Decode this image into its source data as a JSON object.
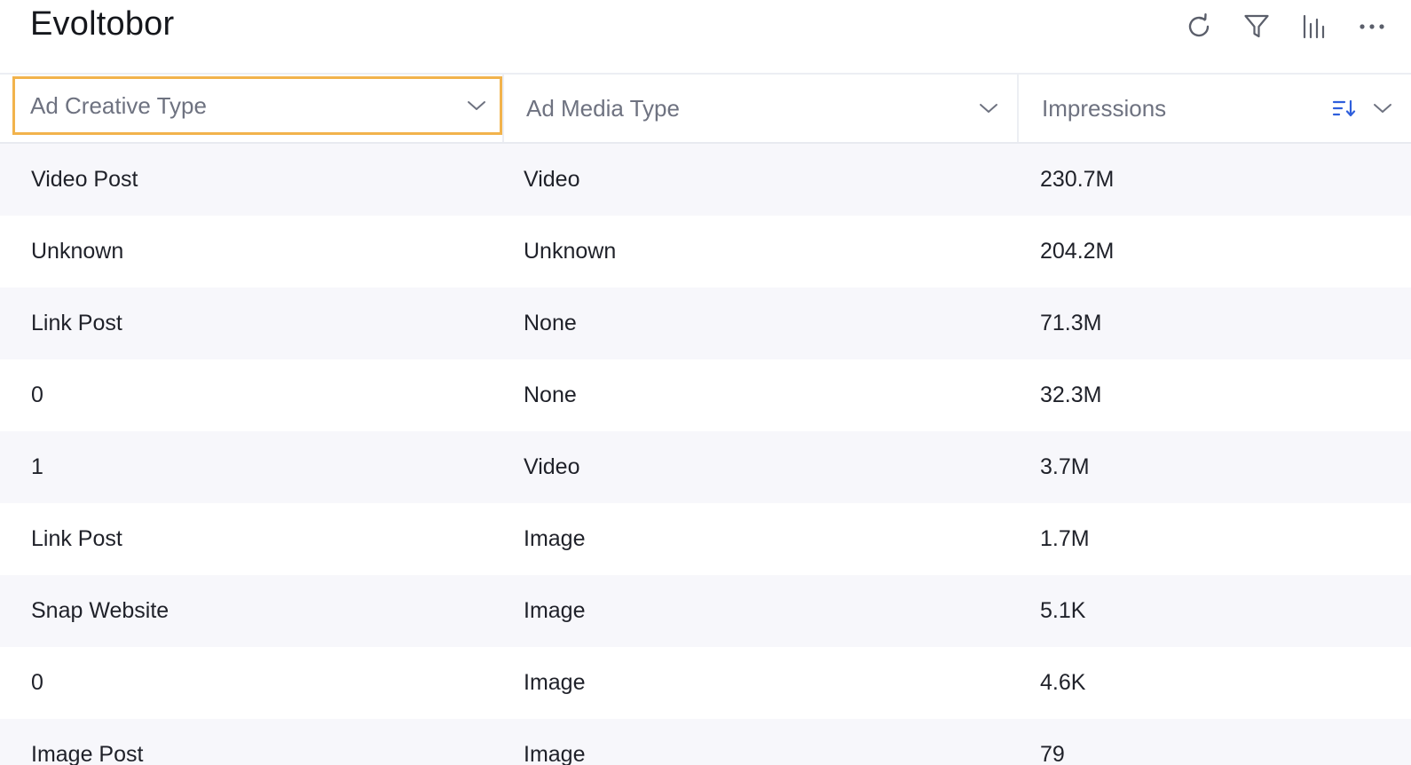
{
  "header": {
    "title": "Evoltobor",
    "toolbar": [
      {
        "icon": "refresh-icon"
      },
      {
        "icon": "filter-icon"
      },
      {
        "icon": "chart-bars-icon"
      },
      {
        "icon": "more-icon"
      }
    ]
  },
  "columns": [
    {
      "label": "Ad Creative Type",
      "focused": true
    },
    {
      "label": "Ad Media Type"
    },
    {
      "label": "Impressions",
      "sorted": "descending"
    }
  ],
  "rows": [
    [
      "Video Post",
      "Video",
      "230.7M"
    ],
    [
      "Unknown",
      "Unknown",
      "204.2M"
    ],
    [
      "Link Post",
      "None",
      "71.3M"
    ],
    [
      "0",
      "None",
      "32.3M"
    ],
    [
      "1",
      "Video",
      "3.7M"
    ],
    [
      "Link Post",
      "Image",
      "1.7M"
    ],
    [
      "Snap Website",
      "Image",
      "5.1K"
    ],
    [
      "0",
      "Image",
      "4.6K"
    ],
    [
      "Image Post",
      "Image",
      "79"
    ]
  ],
  "colors": {
    "focus_border": "#f2b34c",
    "sort_icon": "#2f5fdc",
    "alt_row": "#f7f7fb",
    "header_text": "#6e7280"
  }
}
